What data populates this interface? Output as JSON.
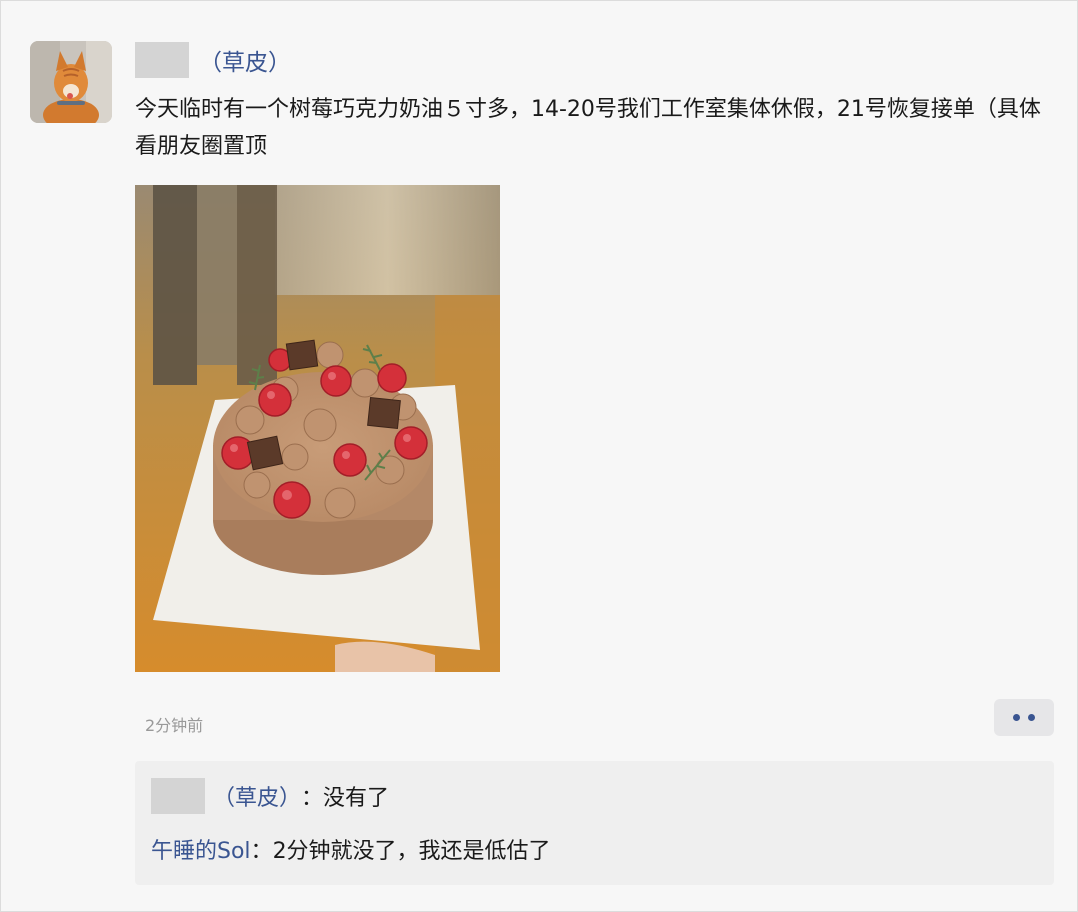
{
  "post": {
    "author_name_tag": "（草皮）",
    "text": "今天临时有一个树莓巧克力奶油５寸多，14-20号我们工作室集体休假，21号恢复接单（具体看朋友圈置顶",
    "time": "2分钟前"
  },
  "actions": {
    "more_icon": "more-dots-icon"
  },
  "comments": [
    {
      "author": "（草皮）",
      "separator": "：",
      "text": "没有了"
    },
    {
      "author": "午睡的Sol",
      "separator": "：",
      "text": "2分钟就没了，我还是低估了"
    }
  ],
  "colors": {
    "link_blue": "#3a5591",
    "timestamp_gray": "#999999",
    "background": "#f7f7f7",
    "comment_bg": "#efefef"
  }
}
